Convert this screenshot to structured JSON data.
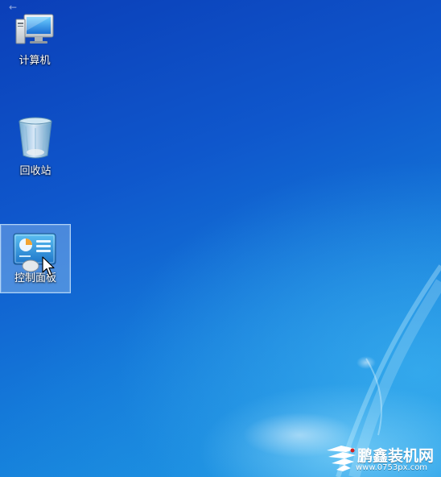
{
  "desktop": {
    "back_glyph": "←",
    "icons": [
      {
        "label": "计算机",
        "icon": "computer-icon",
        "selected": false
      },
      {
        "label": "回收站",
        "icon": "recycle-bin-icon",
        "selected": false
      },
      {
        "label": "控制面板",
        "icon": "control-panel-icon",
        "selected": true
      }
    ]
  },
  "watermark": {
    "title": "鹏鑫装机网",
    "url": "www.0753px.com"
  },
  "colors": {
    "wallpaper_top": "#0b3fb8",
    "wallpaper_bottom": "#1c9ae3",
    "selection_fill": "#aad2f5"
  }
}
